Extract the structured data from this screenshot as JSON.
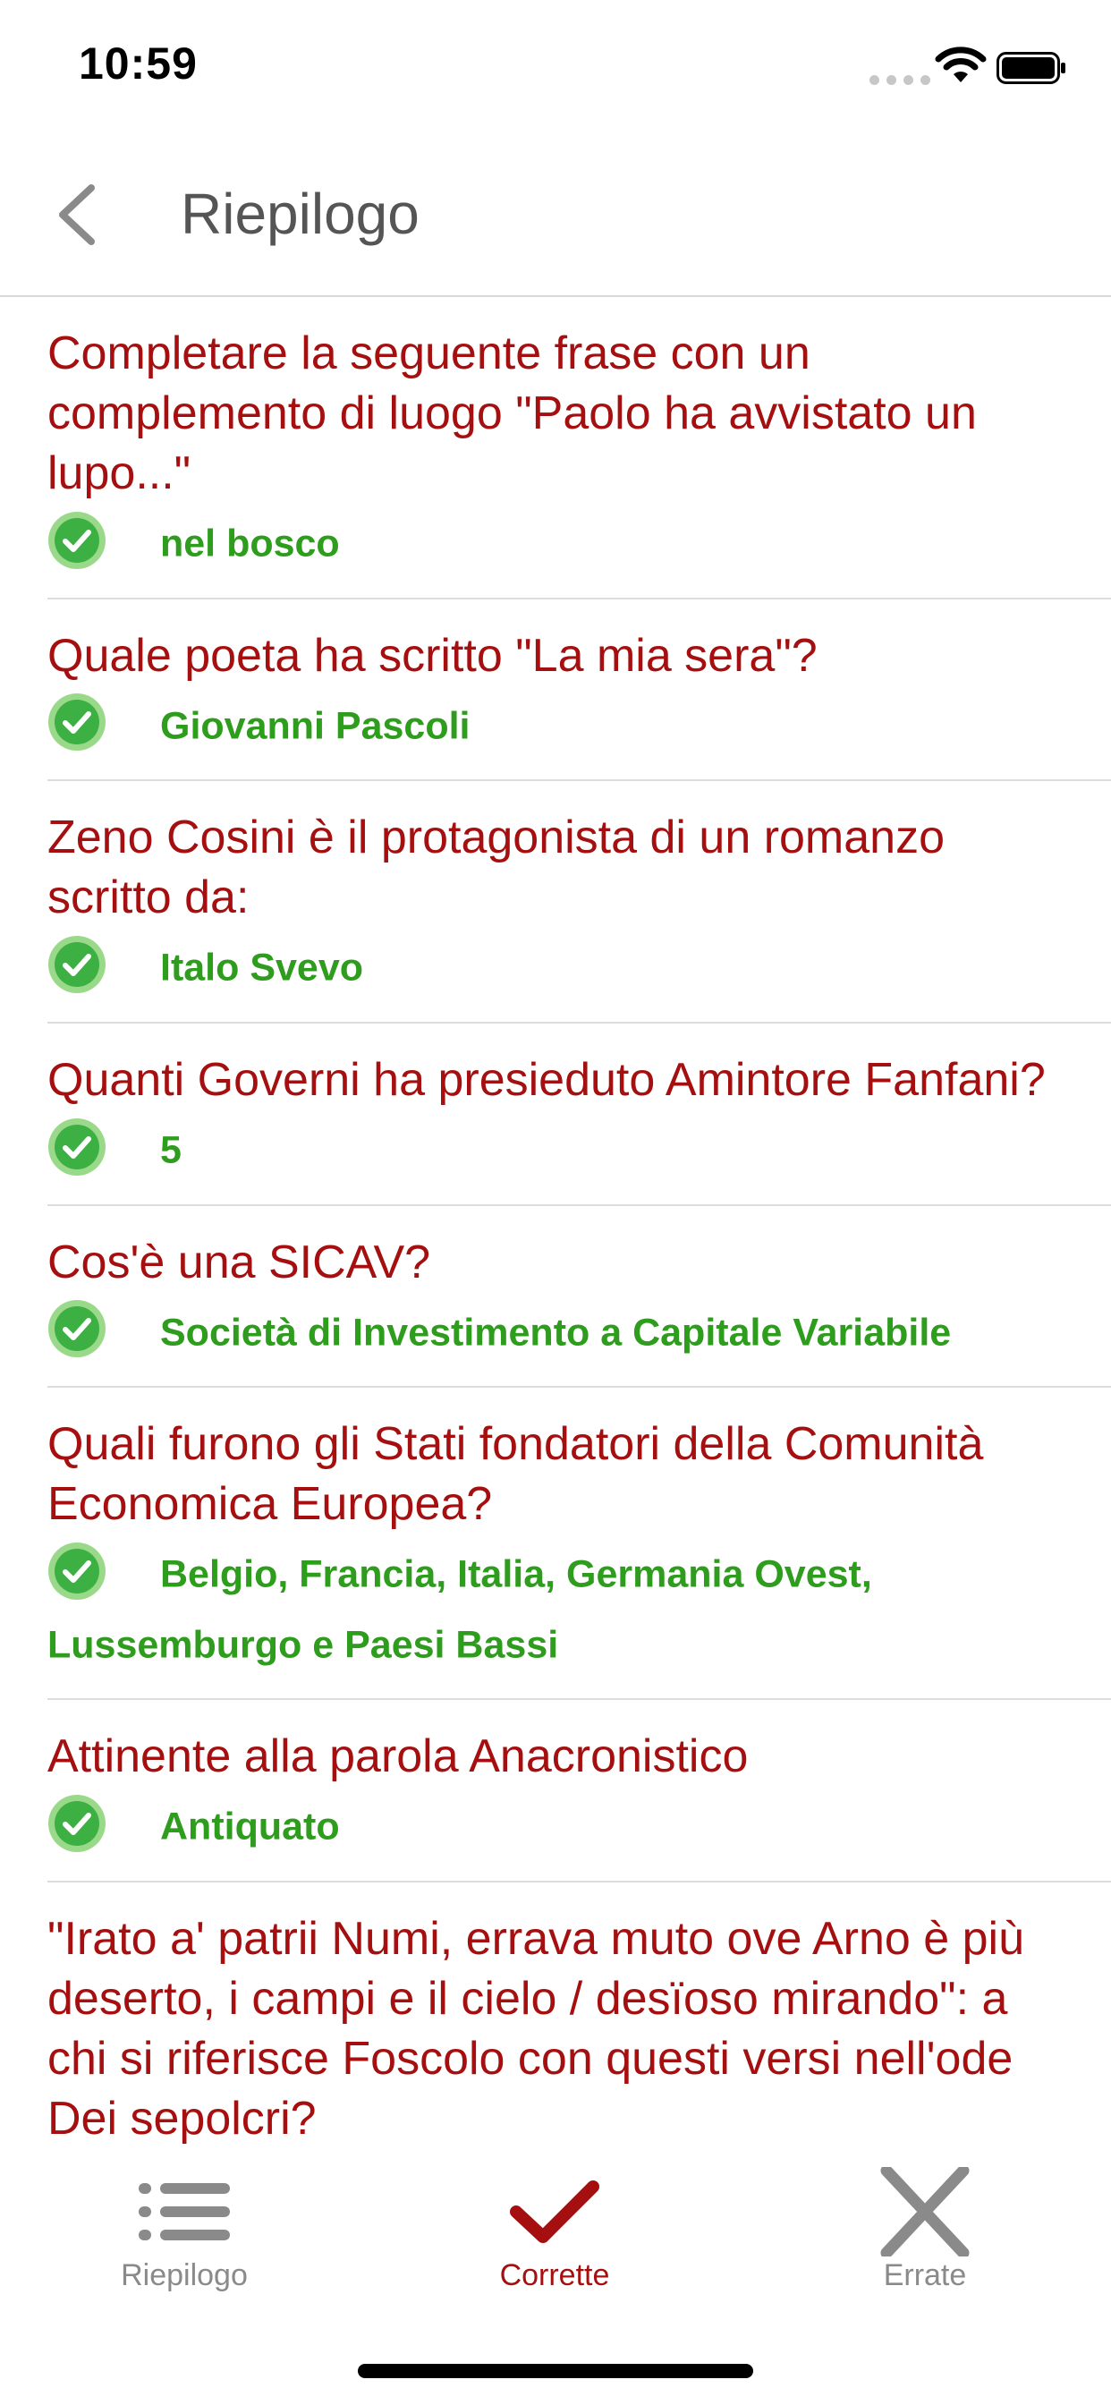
{
  "status_bar": {
    "time": "10:59"
  },
  "nav": {
    "title": "Riepilogo"
  },
  "colors": {
    "question": "#a50f0f",
    "answer": "#2e9c1c",
    "check": "#3cb043",
    "tab_active": "#a50f0f",
    "tab_inactive": "#8a8a8a"
  },
  "items": [
    {
      "question": "Completare la seguente frase con un complemento di luogo \"Paolo ha avvistato un lupo...\"",
      "answer": "nel bosco"
    },
    {
      "question": "Quale poeta ha scritto \"La mia sera\"?",
      "answer": "Giovanni Pascoli"
    },
    {
      "question": "Zeno Cosini è il protagonista di un romanzo scritto da:",
      "answer": "Italo Svevo"
    },
    {
      "question": "Quanti Governi ha presieduto Amintore Fanfani?",
      "answer": "5"
    },
    {
      "question": "Cos'è una SICAV?",
      "answer": "Società di Investimento a Capitale Variabile"
    },
    {
      "question": "Quali furono gli Stati fondatori della Comunità Economica Europea?",
      "answer": "Belgio, Francia, Italia, Germania Ovest, Lussemburgo e Paesi Bassi"
    },
    {
      "question": "Attinente alla parola Anacronistico",
      "answer": "Antiquato"
    },
    {
      "question": "\"Irato a' patrii Numi, errava muto ove Arno è più deserto, i campi e il cielo / desïoso mirando\": a chi si riferisce Foscolo con questi versi nell'ode Dei sepolcri?",
      "answer": ""
    }
  ],
  "tabs": [
    {
      "label": "Riepilogo",
      "icon": "list-icon",
      "active": false
    },
    {
      "label": "Corrette",
      "icon": "checkmark-icon",
      "active": true
    },
    {
      "label": "Errate",
      "icon": "x-icon",
      "active": false
    }
  ]
}
